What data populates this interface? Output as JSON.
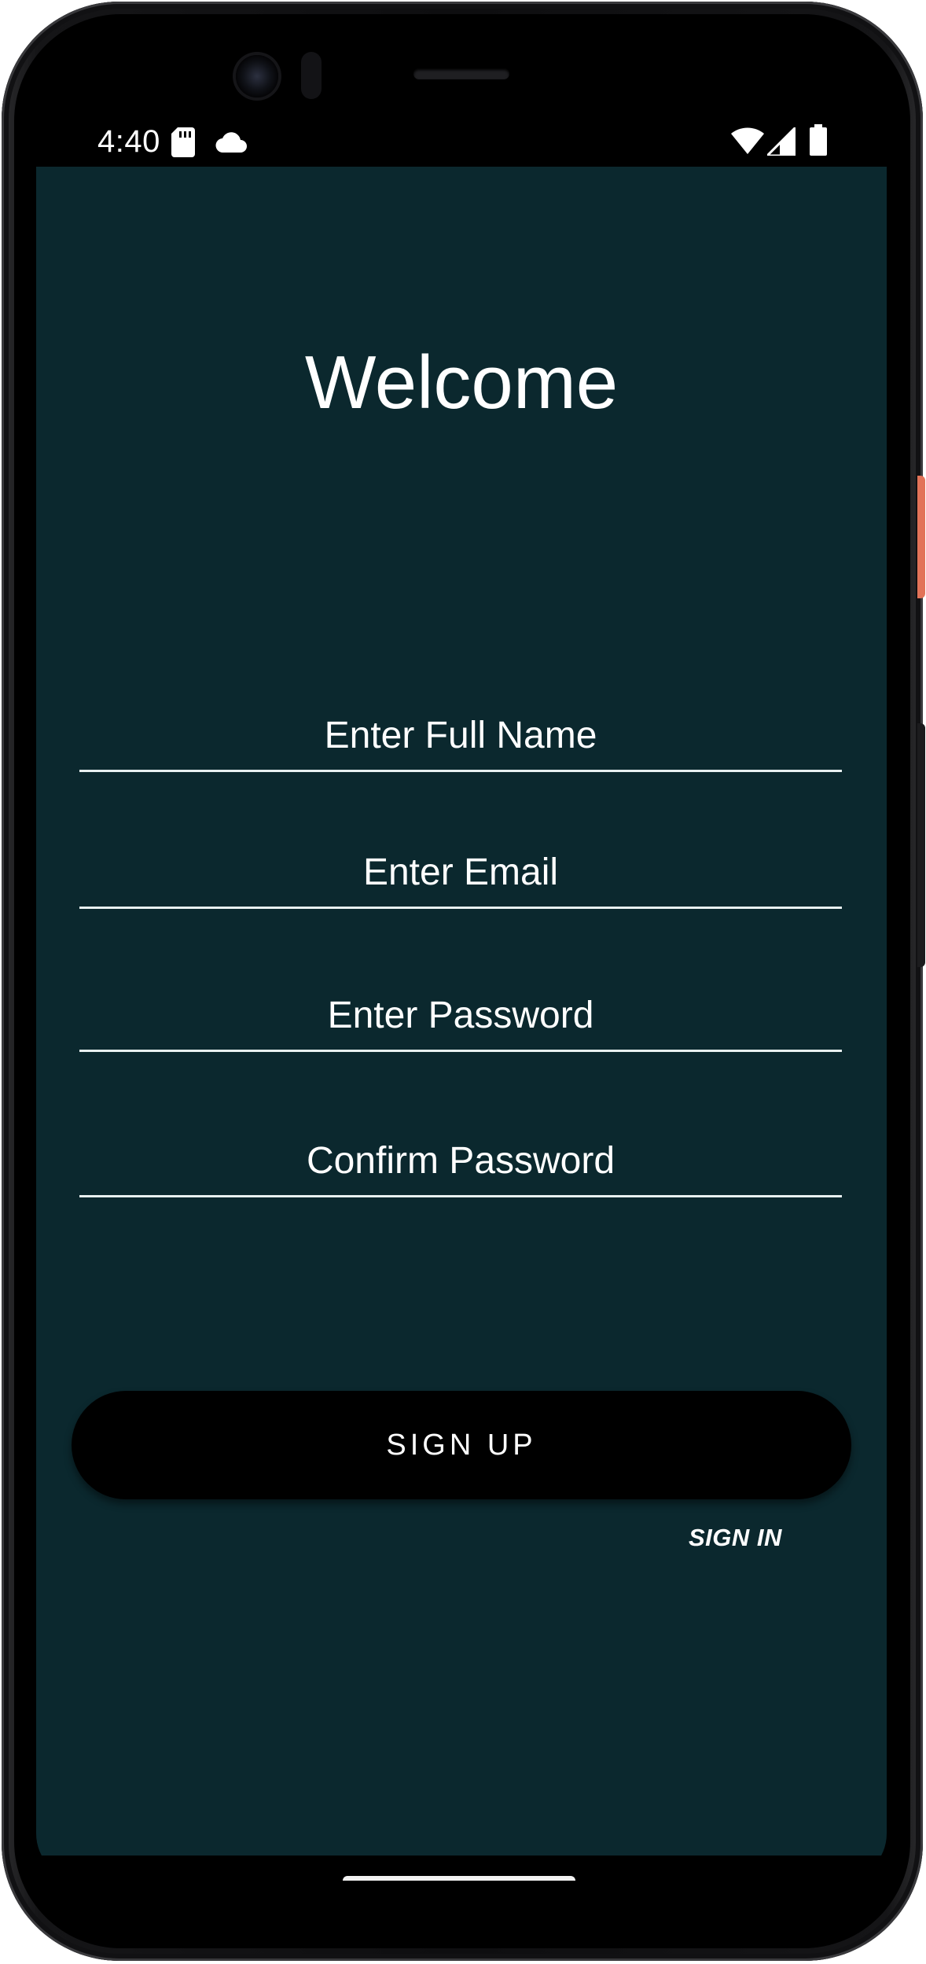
{
  "status_bar": {
    "time": "4:40",
    "icons": [
      "sd-card-icon",
      "cloud-icon",
      "wifi-icon",
      "cell-signal-icon",
      "battery-icon"
    ]
  },
  "screen": {
    "title": "Welcome",
    "fields": {
      "full_name_placeholder": "Enter Full Name",
      "email_placeholder": "Enter Email",
      "password_placeholder": "Enter Password",
      "confirm_password_placeholder": "Confirm Password"
    },
    "signup_label": "SIGN UP",
    "signin_label": "SIGN IN"
  },
  "colors": {
    "background": "#0b282e",
    "button": "#000000",
    "text": "#ffffff",
    "underline": "#e8f0f0"
  }
}
